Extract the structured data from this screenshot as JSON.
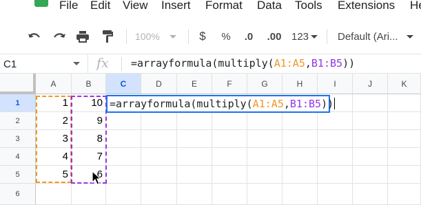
{
  "menubar": {
    "items": [
      "File",
      "Edit",
      "View",
      "Insert",
      "Format",
      "Data",
      "Tools",
      "Extensions",
      "He"
    ]
  },
  "toolbar": {
    "undo_icon": "undo-icon",
    "redo_icon": "redo-icon",
    "print_icon": "print-icon",
    "paint_format_icon": "paint-format-icon",
    "zoom": "100%",
    "currency": "$",
    "percent": "%",
    "decrease_decimal": ".0",
    "increase_decimal": ".00",
    "more_formats": "123",
    "font": "Default (Ari..."
  },
  "formula_bar": {
    "cell_ref": "C1",
    "fx": "fx",
    "formula_prefix": "=arrayformula(multiply(",
    "ref1": "A1:A5",
    "comma": ",",
    "ref2": "B1:B5",
    "formula_suffix": "))"
  },
  "grid": {
    "columns": [
      "A",
      "B",
      "C",
      "D",
      "E",
      "F",
      "G",
      "H",
      "I",
      "J",
      "K"
    ],
    "rows": [
      "1",
      "2",
      "3",
      "4",
      "5",
      "6"
    ],
    "col_a_values": [
      "1",
      "2",
      "3",
      "4",
      "5"
    ],
    "col_b_values": [
      "10",
      "9",
      "8",
      "7",
      "6"
    ],
    "selected_column": "C"
  },
  "editor": {
    "formula_prefix": "=arrayformula(multiply(",
    "ref1": "A1:A5",
    "comma": ",",
    "ref2": "B1:B5",
    "formula_suffix": "))"
  },
  "colors": {
    "range_a": "#f29423",
    "range_b": "#9334e6",
    "selection": "#1a73e8",
    "logo": "#34a853"
  }
}
